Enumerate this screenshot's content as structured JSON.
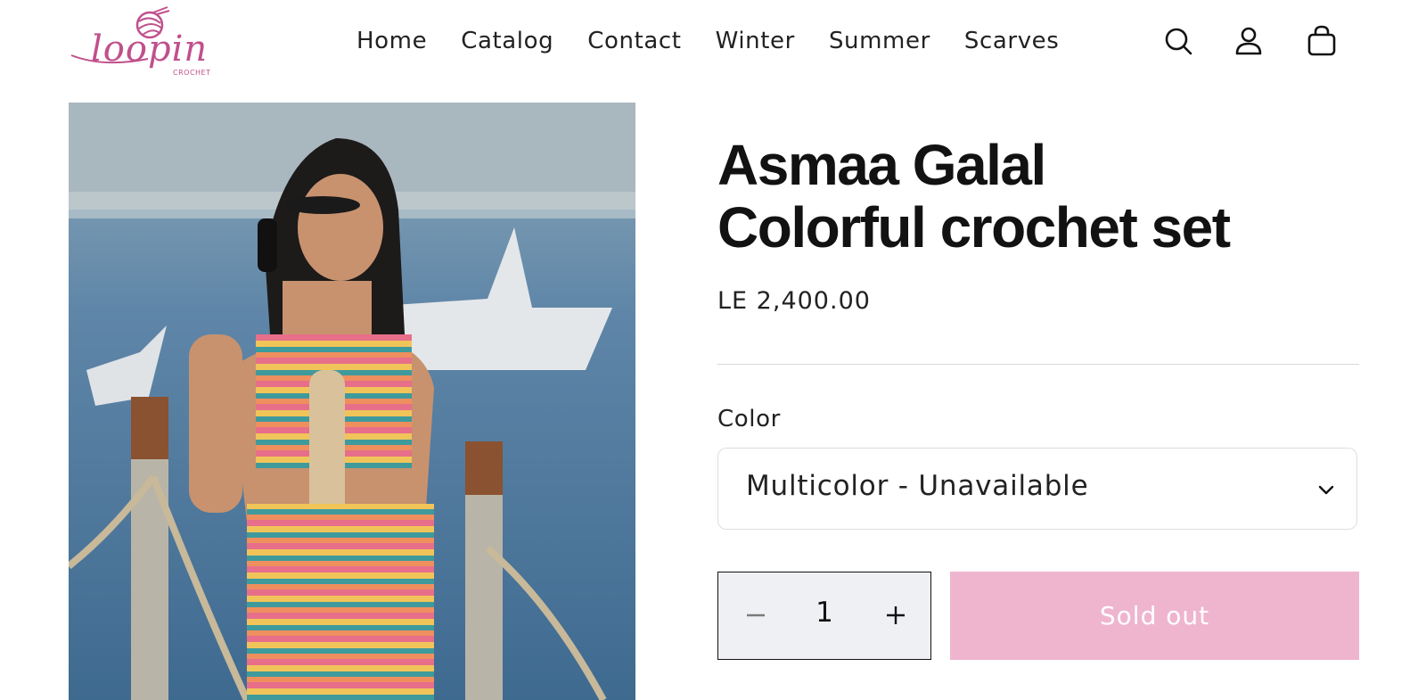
{
  "brand": {
    "logo_text": "loopin",
    "logo_sub": "CROCHET"
  },
  "nav": {
    "items": [
      "Home",
      "Catalog",
      "Contact",
      "Winter",
      "Summer",
      "Scarves"
    ]
  },
  "header_icons": [
    "search-icon",
    "account-icon",
    "cart-icon"
  ],
  "product": {
    "title_line1": "Asmaa Galal",
    "title_line2": "Colorful crochet set",
    "price": "LE 2,400.00",
    "color_label": "Color",
    "color_selected": "Multicolor - Unavailable",
    "quantity": "1",
    "sold_out_label": "Sold out"
  },
  "colors": {
    "brand_pink": "#c0508c",
    "sold_out_bg": "#efb5cf",
    "qty_bg": "#eff0f3"
  }
}
